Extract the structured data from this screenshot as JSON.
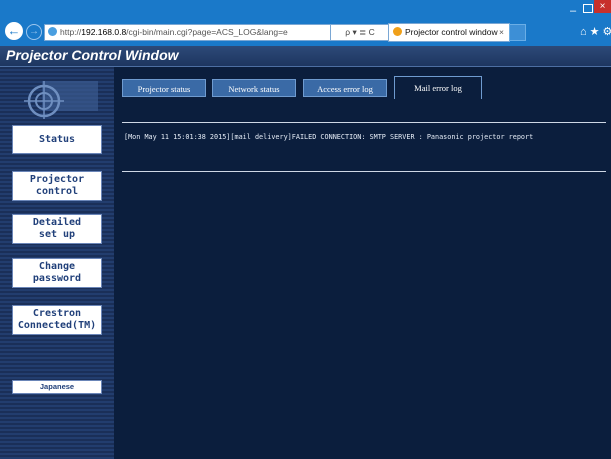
{
  "browser": {
    "url_prefix": "http://",
    "url_host": "192.168.0.8",
    "url_path": "/cgi-bin/main.cgi?page=ACS_LOG&lang=e",
    "search_controls": "ρ ▾ ≣ C",
    "tab_title": "Projector control window",
    "tab_close": "×",
    "win_min": "–",
    "win_close": "×",
    "tool_icons": "⌂★⚙"
  },
  "page": {
    "title": "Projector Control Window"
  },
  "sidebar": {
    "status": "Status",
    "projector_control": "Projector\ncontrol",
    "detailed_setup": "Detailed\nset up",
    "change_password": "Change\npassword",
    "crestron": "Crestron\nConnected(TM)",
    "japanese": "Japanese"
  },
  "tabs": {
    "projector_status": "Projector status",
    "network_status": "Network status",
    "access_error_log": "Access error log",
    "mail_error_log": "Mail error log"
  },
  "log": {
    "entry": "[Mon May 11 15:01:38 2015][mail delivery]FAILED CONNECTION: SMTP SERVER : Panasonic projector report"
  }
}
